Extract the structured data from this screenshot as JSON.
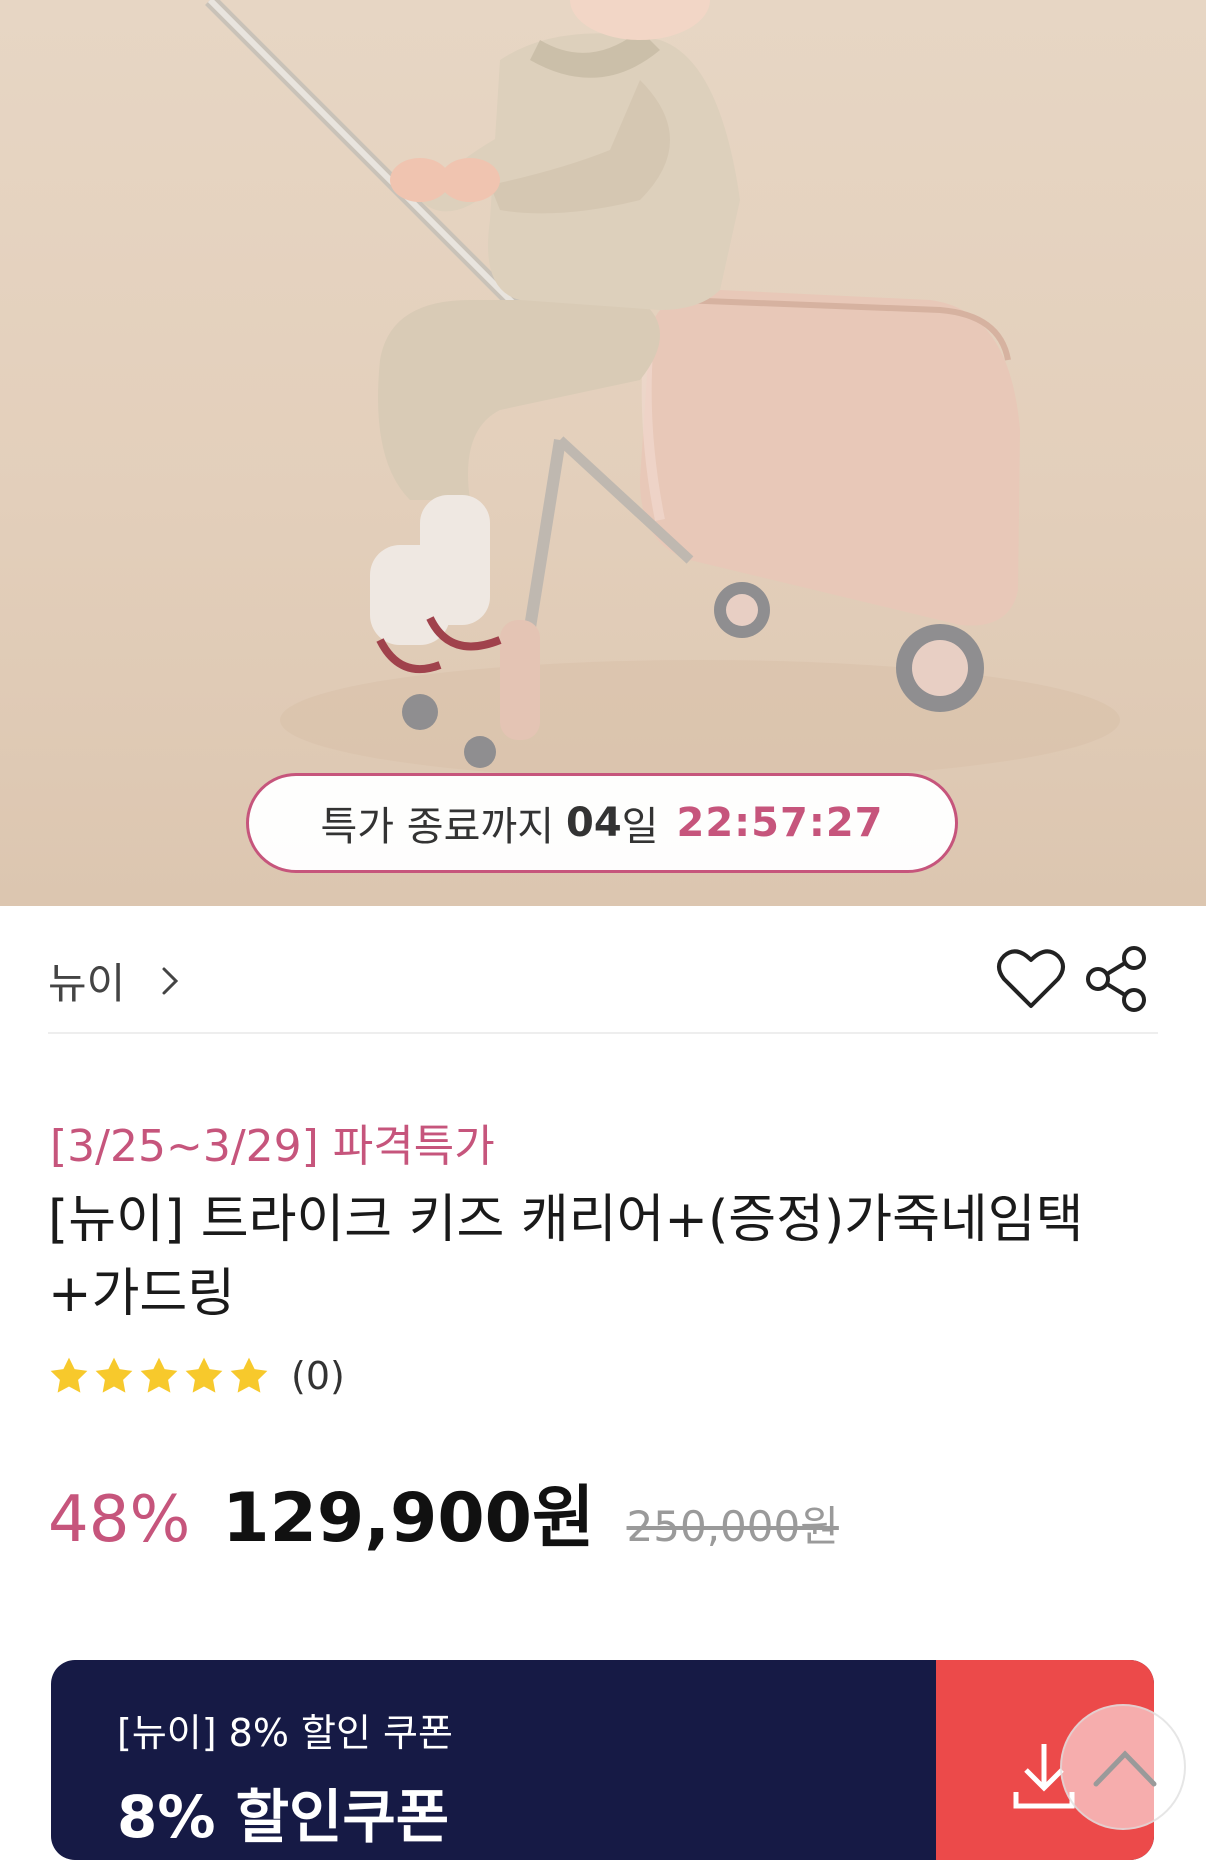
{
  "hero": {
    "timer": {
      "label": "특가 종료까지",
      "days": "04",
      "day_unit": "일",
      "hours": "22",
      "minutes": "57",
      "seconds": "27"
    }
  },
  "brand": {
    "name": "뉴이",
    "icons": [
      "chevron-right-icon",
      "heart-icon",
      "share-icon"
    ]
  },
  "product": {
    "promo": "[3/25~3/29] 파격특가",
    "title_line1": "[뉴이] 트라이크 키즈 캐리어+(증정)가죽네임택",
    "title_line2": "+가드링",
    "rating": {
      "stars": 5,
      "review_count": "(0)"
    },
    "discount": "48%",
    "price": "129,900원",
    "original_price": "250,000원"
  },
  "coupon": {
    "subtitle": "[뉴이] 8% 할인 쿠폰",
    "title": "8% 할인쿠폰",
    "icon": "download-icon"
  },
  "scroll_top": {
    "icon": "chevron-up-icon"
  },
  "colors": {
    "accent": "#c6557c",
    "coupon_bg": "#161a45",
    "coupon_button": "#ec4a4a",
    "star": "#f7c92c"
  }
}
